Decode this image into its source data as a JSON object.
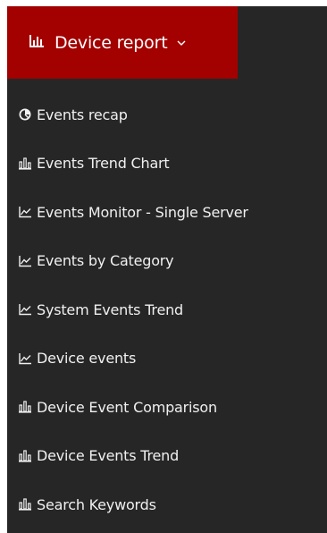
{
  "menu": {
    "title": "Device report",
    "title_icon": "bar-chart-icon",
    "toggle_icon": "chevron-down-icon",
    "header_color": "#a30000",
    "background_color": "#262626",
    "items": [
      {
        "label": "Events recap",
        "icon": "pie-chart-icon"
      },
      {
        "label": "Events Trend Chart",
        "icon": "bar-chart-icon"
      },
      {
        "label": "Events Monitor - Single Server",
        "icon": "line-chart-icon"
      },
      {
        "label": "Events by Category",
        "icon": "line-chart-icon"
      },
      {
        "label": "System Events Trend",
        "icon": "line-chart-icon"
      },
      {
        "label": "Device events",
        "icon": "line-chart-icon"
      },
      {
        "label": "Device Event Comparison",
        "icon": "bar-chart-icon"
      },
      {
        "label": "Device Events Trend",
        "icon": "bar-chart-icon"
      },
      {
        "label": "Search Keywords",
        "icon": "bar-chart-icon"
      }
    ]
  }
}
